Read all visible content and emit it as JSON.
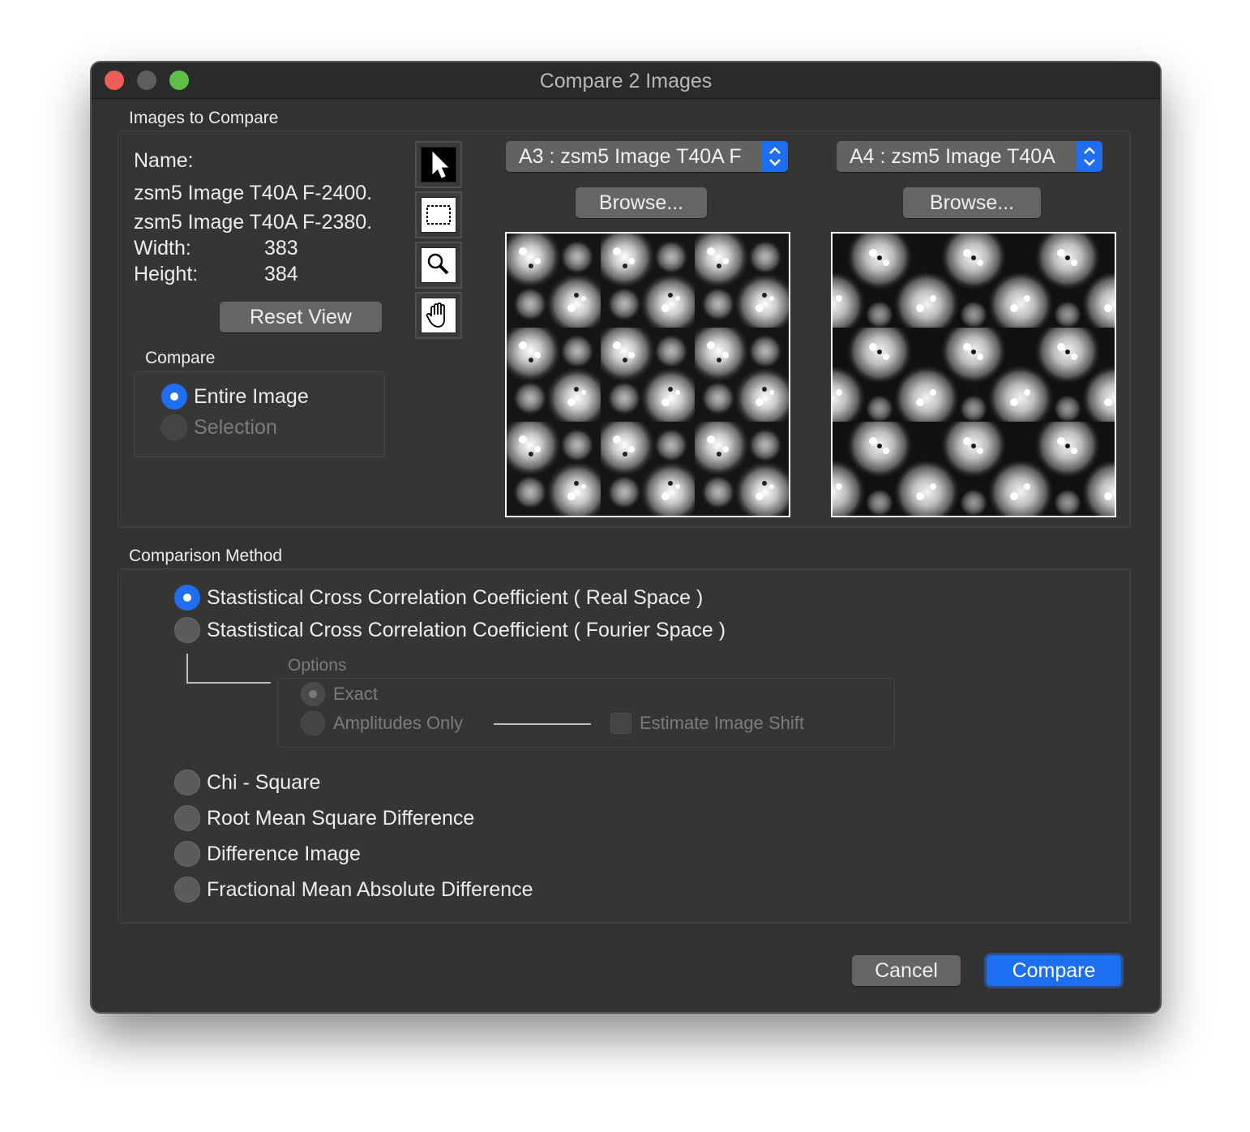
{
  "window": {
    "title": "Compare 2 Images"
  },
  "images_section": {
    "label": "Images to Compare",
    "name_label": "Name:",
    "name_1": "zsm5 Image T40A F-2400.",
    "name_2": "zsm5 Image T40A F-2380.",
    "width_label": "Width:",
    "width_value": "383",
    "height_label": "Height:",
    "height_value": "384",
    "reset_view": "Reset View",
    "compare_label": "Compare",
    "compare_options": [
      "Entire Image",
      "Selection"
    ],
    "image_a_popup": "A3 : zsm5 Image T40A F",
    "image_b_popup": "A4 : zsm5 Image T40A",
    "browse_a": "Browse...",
    "browse_b": "Browse...",
    "tools": [
      "arrow-icon",
      "marquee-icon",
      "magnifier-icon",
      "hand-icon"
    ]
  },
  "method_section": {
    "label": "Comparison Method",
    "methods": [
      "Stastistical Cross Correlation Coefficient ( Real Space )",
      "Stastistical Cross Correlation Coefficient ( Fourier Space )",
      "Chi - Square",
      "Root Mean Square Difference",
      "Difference Image",
      "Fractional Mean Absolute Difference"
    ],
    "options_label": "Options",
    "option_exact": "Exact",
    "option_amplitudes": "Amplitudes Only",
    "estimate_shift": "Estimate Image Shift"
  },
  "footer": {
    "cancel": "Cancel",
    "compare": "Compare"
  },
  "colors": {
    "window_bg": "#323232",
    "accent": "#1f6ef0",
    "close": "#ec5f57",
    "maximize": "#5fbf47"
  }
}
